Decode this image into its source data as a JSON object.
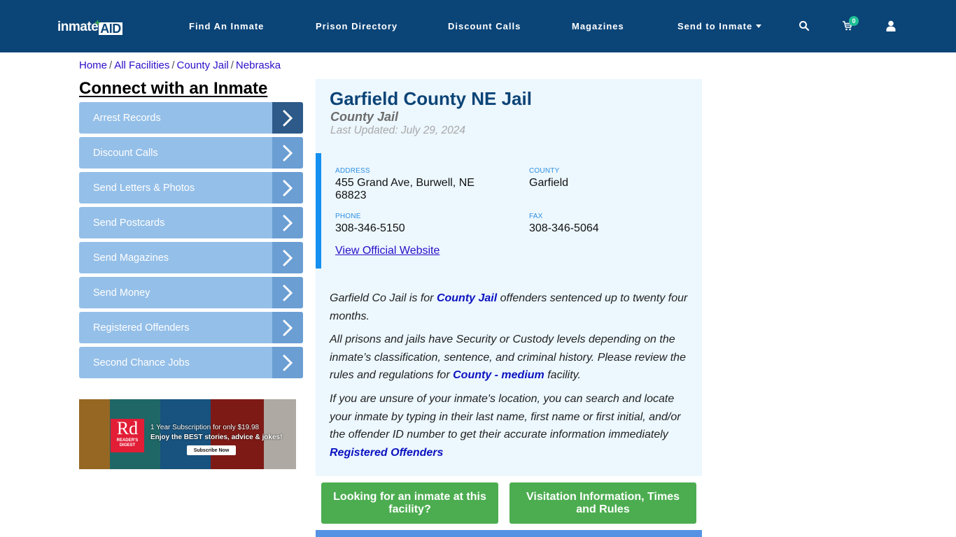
{
  "header": {
    "logo_text": "inmate",
    "logo_accent": "AID",
    "nav": [
      {
        "label": "Find An Inmate"
      },
      {
        "label": "Prison Directory"
      },
      {
        "label": "Discount Calls"
      },
      {
        "label": "Magazines"
      },
      {
        "label": "Send to Inmate",
        "has_dropdown": true
      }
    ],
    "icons": [
      "search-icon",
      "cart-icon",
      "user-icon"
    ],
    "cart_count": "0"
  },
  "breadcrumb": [
    {
      "label": "Home"
    },
    {
      "label": "All Facilities"
    },
    {
      "label": "County Jail"
    },
    {
      "label": "Nebraska"
    }
  ],
  "breadcrumb_sep": "/",
  "sidebar": {
    "title": "Connect with an Inmate",
    "items": [
      {
        "label": "Arrest Records"
      },
      {
        "label": "Discount Calls"
      },
      {
        "label": "Send Letters & Photos"
      },
      {
        "label": "Send Postcards"
      },
      {
        "label": "Send Magazines"
      },
      {
        "label": "Send Money"
      },
      {
        "label": "Registered Offenders"
      },
      {
        "label": "Second Chance Jobs"
      }
    ],
    "ad": {
      "brand_big": "Rd",
      "brand_small": "READER'S DIGEST",
      "line1": "1 Year Subscription for only $19.98",
      "line2": "Enjoy the BEST stories, advice & jokes!",
      "cta": "Subscribe Now"
    }
  },
  "facility": {
    "name": "Garfield County NE Jail",
    "type": "County Jail",
    "last_updated": "Last Updated: July 29, 2024",
    "address_label": "ADDRESS",
    "address_line1": "455 Grand Ave, Burwell, NE",
    "address_line2": "68823",
    "county_label": "COUNTY",
    "county": "Garfield",
    "phone_label": "PHONE",
    "phone": "308-346-5150",
    "fax_label": "FAX",
    "fax": "308-346-5064",
    "website_link": "View Official Website"
  },
  "description": {
    "p1_a": "Garfield Co Jail is for ",
    "p1_link": "County Jail",
    "p1_b": " offenders sentenced up to twenty four months.",
    "p2_a": "All prisons and jails have Security or Custody levels depending on the inmate’s classification, sentence, and criminal history. Please review the rules and regulations for ",
    "p2_link": "County - medium",
    "p2_b": " facility.",
    "p3": "If you are unsure of your inmate's location, you can search and locate your inmate by typing in their last name, first name or first initial, and/or the offender ID number to get their accurate information immediately",
    "p3_link": "Registered Offenders"
  },
  "actions": {
    "find_inmate": "Looking for an inmate at this facility?",
    "visitation": "Visitation Information, Times and Rules"
  },
  "colors": {
    "header_bg": "#0b4477",
    "panel_bg": "#ecf7fe",
    "accent_blue": "#1590f0",
    "button_green": "#4cad50",
    "sidebar_item": "#94bfe8",
    "sidebar_arrow": "#6b9ed3"
  }
}
